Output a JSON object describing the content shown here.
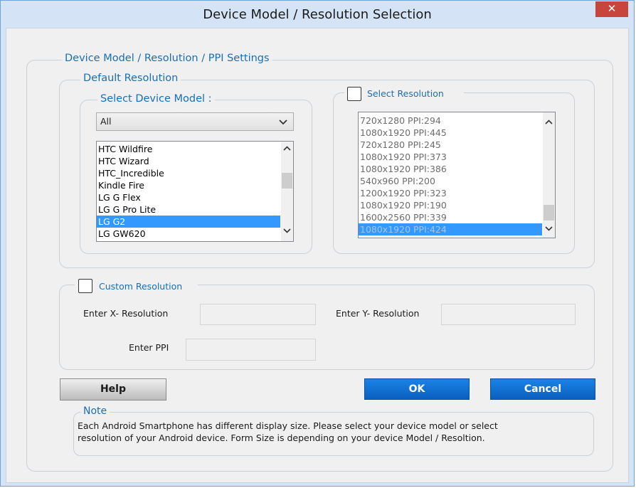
{
  "window": {
    "title": "Device Model / Resolution Selection",
    "close_glyph": "✕"
  },
  "settings": {
    "group_title": "Device Model / Resolution / PPI Settings"
  },
  "default_resolution": {
    "group_title": "Default Resolution",
    "device_model": {
      "group_title": "Select Device Model :",
      "filter_selected": "All",
      "items": [
        "HTC Wildfire",
        "HTC Wizard",
        "HTC_Incredible",
        "Kindle Fire",
        "LG G Flex",
        "LG G Pro Lite",
        "LG G2",
        "LG GW620"
      ],
      "selected": "LG G2"
    },
    "resolution": {
      "checkbox_label": "Select Resolution",
      "checked": false,
      "items": [
        "720x1280 PPI:294",
        "1080x1920 PPI:445",
        "720x1280 PPI:245",
        "1080x1920 PPI:373",
        "1080x1920 PPI:386",
        "540x960 PPI:200",
        "1200x1920 PPI:323",
        "1080x1920 PPI:190",
        "1600x2560 PPI:339",
        "1080x1920 PPI:424"
      ],
      "selected": "1080x1920 PPI:424"
    }
  },
  "custom_resolution": {
    "checkbox_label": "Custom Resolution",
    "checked": false,
    "x_label": "Enter X- Resolution",
    "y_label": "Enter Y- Resolution",
    "ppi_label": "Enter PPI",
    "x_value": "",
    "y_value": "",
    "ppi_value": ""
  },
  "buttons": {
    "help": "Help",
    "ok": "OK",
    "cancel": "Cancel"
  },
  "note": {
    "title": "Note",
    "line1": "Each Android Smartphone has different display size. Please select your device model or select",
    "line2": "resolution of your Android device. Form Size is depending on your device Model / Resoltion."
  },
  "icons": {
    "close": "close-icon",
    "dropdown": "chevron-down-icon",
    "scroll_up": "scroll-up-icon",
    "scroll_down": "scroll-down-icon"
  },
  "colors": {
    "legend": "#1a6eb5",
    "selection": "#3399ff",
    "primary_button": "#0a6cd6",
    "close_button": "#c7453c",
    "title_bar": "#d4e4f6"
  }
}
